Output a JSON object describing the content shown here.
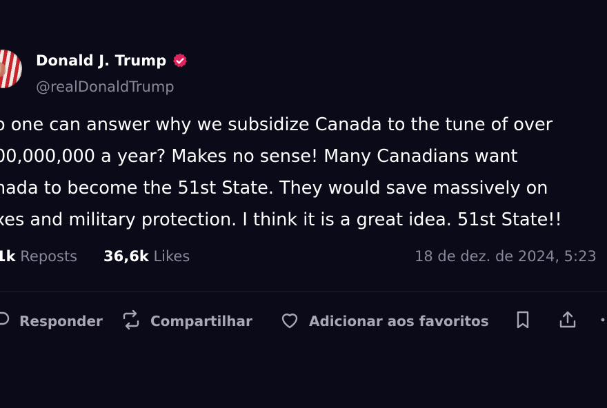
{
  "author": {
    "display_name": "Donald J. Trump",
    "handle": "@realDonaldTrump"
  },
  "tweet": {
    "lines": [
      "o one can answer why we subsidize Canada to the tune of over",
      "00,000,000 a year? Makes no sense! Many Canadians want",
      "nada to become the 51st State. They would save massively on",
      "xes and military protection. I think it is a great idea. 51st State!!"
    ]
  },
  "stats": {
    "reposts_count": "1k",
    "reposts_label": "Reposts",
    "likes_count": "36,6k",
    "likes_label": "Likes",
    "timestamp": "18 de dez. de 2024, 5:23"
  },
  "actions": {
    "reply_label": "Responder",
    "share_label": "Compartilhar",
    "favorite_label": "Adicionar aos favoritos"
  },
  "icons": {
    "verified": "verified-badge-icon",
    "reply": "reply-icon",
    "share": "repost-icon",
    "favorite": "heart-icon",
    "bookmark": "bookmark-icon",
    "upload": "share-upload-icon"
  },
  "colors": {
    "background": "#0b0a19",
    "verified": "#e0245e",
    "muted_text": "#8a8898"
  }
}
